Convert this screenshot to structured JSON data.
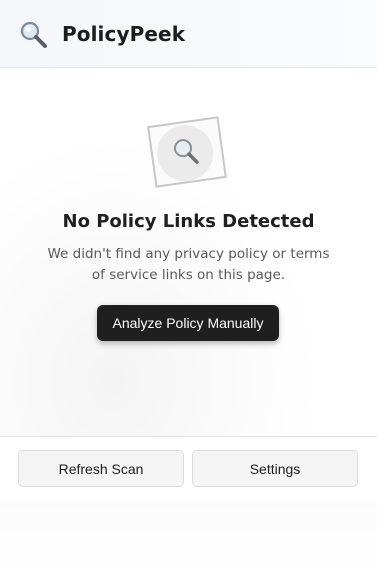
{
  "header": {
    "title": "PolicyPeek",
    "logo_icon": "magnifying-glass-icon"
  },
  "empty_state": {
    "icon": "magnifying-glass-icon",
    "title": "No Policy Links Detected",
    "description": "We didn't find any privacy policy or terms of service links on this page.",
    "primary_button": "Analyze Policy Manually"
  },
  "footer": {
    "refresh_label": "Refresh Scan",
    "settings_label": "Settings"
  },
  "colors": {
    "primary_button_bg": "#1f1f1f",
    "header_bg": "#f4f6f9"
  }
}
